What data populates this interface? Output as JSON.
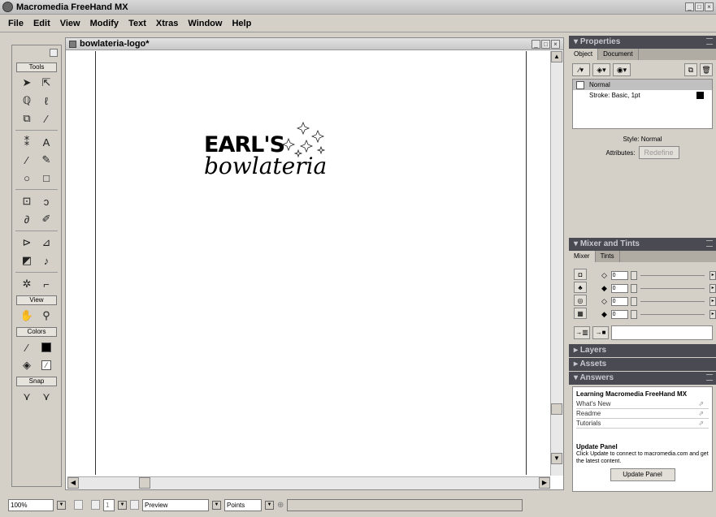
{
  "app": {
    "title": "Macromedia FreeHand MX"
  },
  "menu": [
    "File",
    "Edit",
    "View",
    "Modify",
    "Text",
    "Xtras",
    "Window",
    "Help"
  ],
  "tools_panel": {
    "group_tools": "Tools",
    "group_view": "View",
    "group_colors": "Colors",
    "group_snap": "Snap",
    "icons": [
      "pointer-icon",
      "subselect-icon",
      "lasso-icon",
      "pen-curve-icon",
      "page-icon",
      "eyedropper-icon",
      "knife-icon",
      "text-icon",
      "line-icon",
      "pencil-icon",
      "ellipse-icon",
      "rectangle-icon",
      "freeform-icon",
      "spiral-icon",
      "bezigon-icon",
      "brush-icon",
      "scale-icon",
      "rotate-icon",
      "blend-icon",
      "warp-icon",
      "symbol-icon",
      "connector-icon"
    ]
  },
  "document": {
    "name": "bowlateria-logo*",
    "logo_line1": "EARL'S",
    "logo_line2": "bowlateria"
  },
  "properties": {
    "header": "Properties",
    "tabs": [
      "Object",
      "Document"
    ],
    "selected_item": "Normal",
    "stroke_item": "Stroke: Basic, 1pt",
    "style_text": "Style: Normal",
    "attributes_label": "Attributes:",
    "redefine_button": "Redefine"
  },
  "mixer": {
    "header": "Mixer and Tints",
    "tabs": [
      "Mixer",
      "Tints"
    ],
    "values": [
      "0",
      "0",
      "0",
      "0"
    ]
  },
  "layers": {
    "header": "Layers"
  },
  "assets": {
    "header": "Assets"
  },
  "answers": {
    "header": "Answers",
    "learning_title": "Learning Macromedia FreeHand MX",
    "links": [
      "What's New",
      "Readme",
      "Tutorials"
    ],
    "update_title": "Update Panel",
    "update_text": "Click Update to connect to macromedia.com and get the latest content.",
    "update_button": "Update Panel"
  },
  "status": {
    "zoom": "100%",
    "page_number": "1",
    "view_mode": "Preview",
    "units": "Points"
  },
  "colors": {
    "panel_header": "#4a4a52",
    "panel_bg": "#d4d0c8"
  }
}
